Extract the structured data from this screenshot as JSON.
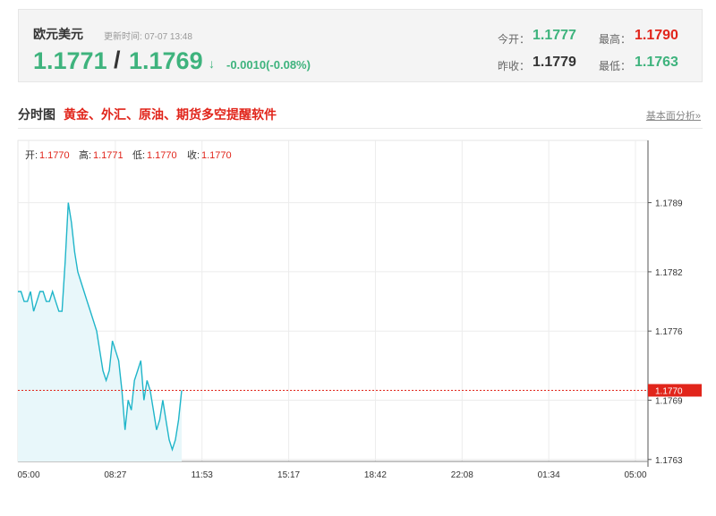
{
  "quote": {
    "pair": "欧元美元",
    "update_label": "更新时间: 07-07 13:48",
    "bid": "1.1771",
    "slash": "/",
    "ask": "1.1769",
    "arrow": "↓",
    "change": "-0.0010(-0.08%)",
    "open_label": "今开：",
    "open_value": "1.1777",
    "high_label": "最高：",
    "high_value": "1.1790",
    "prev_close_label": "昨收：",
    "prev_close_value": "1.1779",
    "low_label": "最低：",
    "low_value": "1.1763"
  },
  "chart_header": {
    "title": "分时图",
    "promo_link": "黄金、外汇、原油、期货多空提醒软件",
    "basic_analysis": "基本面分析»"
  },
  "ohlc": {
    "open_label": "开:",
    "open_value": "1.1770",
    "high_label": "高:",
    "high_value": "1.1771",
    "low_label": "低:",
    "low_value": "1.1770",
    "close_label": "收:",
    "close_value": "1.1770"
  },
  "colors": {
    "up_green": "#3eb37d",
    "down_red": "#e1251b",
    "line": "#1fb5c9",
    "area": "#e8f7fa",
    "current_price_line": "#e1251b"
  },
  "chart_data": {
    "type": "area",
    "y_ticks": [
      "1.1789",
      "1.1782",
      "1.1776",
      "1.1769",
      "1.1763"
    ],
    "y_range": [
      1.17628,
      1.17953
    ],
    "x_ticks": [
      "05:00",
      "08:27",
      "11:53",
      "15:17",
      "18:42",
      "22:08",
      "01:34",
      "05:00"
    ],
    "current_price": 1.177,
    "current_price_label": "1.1770",
    "grid": true,
    "series": [
      {
        "x_index": [
          0,
          5,
          10,
          15,
          20,
          25,
          30,
          35,
          40,
          45,
          50,
          55,
          60,
          65,
          70,
          75,
          80,
          85,
          90,
          95,
          100,
          105,
          110,
          115,
          120,
          125,
          130,
          135,
          140,
          145,
          150,
          155,
          160,
          165,
          170,
          175,
          180,
          185,
          190,
          195,
          200,
          205,
          210,
          215,
          220,
          225,
          230,
          235,
          240,
          245,
          250,
          255,
          260
        ],
        "values": [
          1.178,
          1.178,
          1.1779,
          1.1779,
          1.178,
          1.1778,
          1.1779,
          1.178,
          1.178,
          1.1779,
          1.1779,
          1.178,
          1.1779,
          1.1778,
          1.1778,
          1.1783,
          1.1789,
          1.1787,
          1.1784,
          1.1782,
          1.1781,
          1.178,
          1.1779,
          1.1778,
          1.1777,
          1.1776,
          1.1774,
          1.1772,
          1.1771,
          1.1772,
          1.1775,
          1.1774,
          1.1773,
          1.177,
          1.1766,
          1.1769,
          1.1768,
          1.1771,
          1.1772,
          1.1773,
          1.1769,
          1.1771,
          1.177,
          1.1768,
          1.1766,
          1.1767,
          1.1769,
          1.1767,
          1.1765,
          1.1764,
          1.1765,
          1.1767,
          1.177
        ]
      }
    ]
  }
}
